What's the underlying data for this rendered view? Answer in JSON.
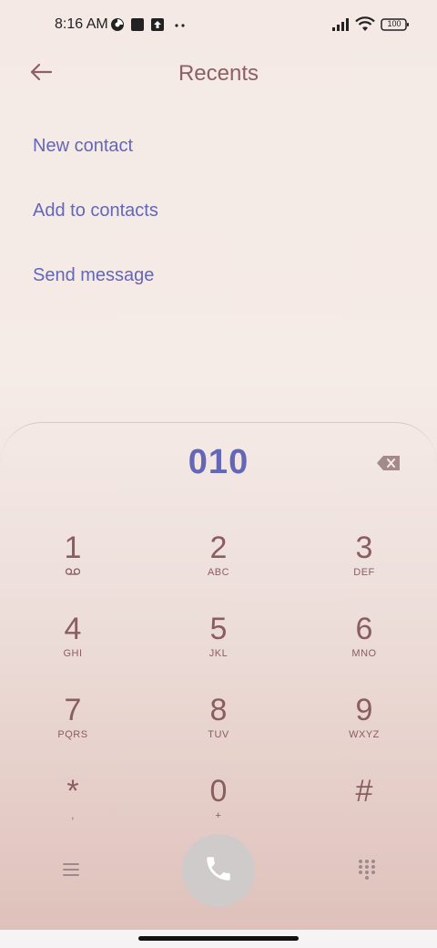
{
  "status_bar": {
    "time": "8:16 AM",
    "battery": "100",
    "icons": [
      "data-saver-icon",
      "square-notification-icon",
      "upload-notification-icon",
      "more-dots-icon",
      "signal-icon",
      "wifi-icon",
      "battery-icon"
    ]
  },
  "header": {
    "title": "Recents",
    "back_icon": "back-arrow-icon"
  },
  "actions": {
    "new_contact": "New contact",
    "add_to_contacts": "Add to contacts",
    "send_message": "Send message"
  },
  "dialpad": {
    "number": "010",
    "keys": [
      {
        "digit": "1",
        "letters": ""
      },
      {
        "digit": "2",
        "letters": "ABC"
      },
      {
        "digit": "3",
        "letters": "DEF"
      },
      {
        "digit": "4",
        "letters": "GHI"
      },
      {
        "digit": "5",
        "letters": "JKL"
      },
      {
        "digit": "6",
        "letters": "MNO"
      },
      {
        "digit": "7",
        "letters": "PQRS"
      },
      {
        "digit": "8",
        "letters": "TUV"
      },
      {
        "digit": "9",
        "letters": "WXYZ"
      },
      {
        "digit": "*",
        "letters": ","
      },
      {
        "digit": "0",
        "letters": "+"
      },
      {
        "digit": "#",
        "letters": ""
      }
    ]
  },
  "colors": {
    "accent": "#6467b7",
    "key_text": "#8a5d61",
    "title": "#8e5f63",
    "call_button": "#cfcbcb"
  }
}
